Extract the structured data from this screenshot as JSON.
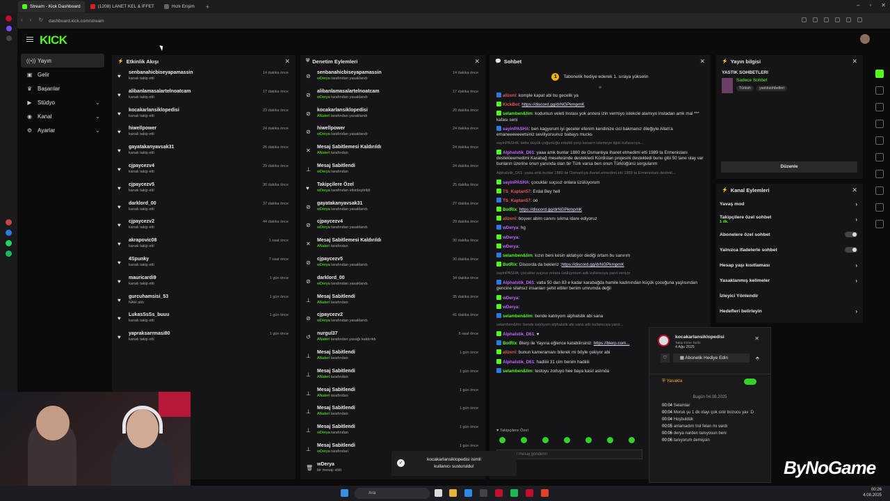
{
  "browser": {
    "tabs": [
      {
        "label": "Stream - Kick Dashboard",
        "active": true
      },
      {
        "label": "(1208) LANET KEL & İFFET",
        "active": false
      },
      {
        "label": "Hızlı Erişim",
        "active": false
      }
    ],
    "url": "dashboard.kick.com/stream"
  },
  "brand": {
    "logo": "KICK",
    "accent": "#53fc18"
  },
  "sidenav": {
    "items": [
      {
        "label": "Yayın",
        "icon": "broadcast-icon",
        "active": true,
        "chevron": false
      },
      {
        "label": "Gelir",
        "icon": "wallet-icon",
        "active": false,
        "chevron": false
      },
      {
        "label": "Başarılar",
        "icon": "trophy-icon",
        "active": false,
        "chevron": false
      },
      {
        "label": "Stüdyo",
        "icon": "video-icon",
        "active": false,
        "chevron": true
      },
      {
        "label": "Kanal",
        "icon": "channel-icon",
        "active": false,
        "chevron": true
      },
      {
        "label": "Ayarlar",
        "icon": "gear-icon",
        "active": false,
        "chevron": true
      }
    ]
  },
  "activity": {
    "title": "Etkinlik Akışı",
    "rows": [
      {
        "name": "senbanahicbiseyapamassin",
        "sub": "kanalı takip etti",
        "time": "14 dakika önce"
      },
      {
        "name": "alibanlamasalartelnoatcam",
        "sub": "kanalı takip etti",
        "time": "17 dakika önce"
      },
      {
        "name": "kocakarlansiklopedisi",
        "sub": "kanalı takip etti",
        "time": "23 dakika önce"
      },
      {
        "name": "hiwellpower",
        "sub": "kanalı takip etti",
        "time": "24 dakika önce"
      },
      {
        "name": "gayatakanyavsak31",
        "sub": "kanalı takip etti",
        "time": "26 dakika önce"
      },
      {
        "name": "cjpaycezv4",
        "sub": "kanalı takip etti",
        "time": "29 dakika önce"
      },
      {
        "name": "cjpaycezv5",
        "sub": "kanalı takip etti",
        "time": "30 dakika önce"
      },
      {
        "name": "darklord_00",
        "sub": "kanalı takip etti",
        "time": "37 dakika önce"
      },
      {
        "name": "cjpaycezv2",
        "sub": "kanalı takip etti",
        "time": "44 dakika önce"
      },
      {
        "name": "akrapovic08",
        "sub": "kanalı takip etti",
        "time": "1 saat önce"
      },
      {
        "name": "4Spunky",
        "sub": "kanalı takip etti",
        "time": "7 saat önce"
      },
      {
        "name": "mauricardi9",
        "sub": "kanalı takip etti",
        "time": "1 gün önce"
      },
      {
        "name": "gurcuhamsisi_53",
        "sub": "NAH aldı",
        "time": "1 gün önce"
      },
      {
        "name": "LukasSsSs_buuu",
        "sub": "kanalı takip etti",
        "time": "1 gün önce"
      },
      {
        "name": "yapraksarrmasi80",
        "sub": "kanalı takip etti",
        "time": "1 gün önce"
      }
    ]
  },
  "moderation": {
    "title": "Denetim Eylemleri",
    "rows": [
      {
        "icon": "ban-icon",
        "name": "senbanahicbiseyapamassin",
        "by": "wDerya",
        "sub": " tarafından yasaklandı",
        "time": "14 dakika önce"
      },
      {
        "icon": "ban-icon",
        "name": "alibanlamasalartelnoatcam",
        "by": "wDerya",
        "sub": " tarafından yasaklandı",
        "time": "17 dakika önce"
      },
      {
        "icon": "ban-icon",
        "name": "kocakarlansiklopedisi",
        "by": "ANaterl",
        "sub": " tarafından yasaklandı",
        "time": "20 dakika önce"
      },
      {
        "icon": "ban-icon",
        "name": "hiwellpower",
        "by": "wDerya",
        "sub": " tarafından yasaklandı",
        "time": "24 dakika önce"
      },
      {
        "icon": "unpin-icon",
        "name": "Mesaj Sabitlemesi Kaldırıldı",
        "by": "ANaterl",
        "sub": " tarafından",
        "time": "24 dakika önce"
      },
      {
        "icon": "pin-icon",
        "name": "Mesaj Sabitlendi",
        "by": "wDerya",
        "sub": " tarafından",
        "time": "24 dakika önce"
      },
      {
        "icon": "heart-icon",
        "name": "Takipçilere Özel",
        "by": "wDerya",
        "sub": " tarafından etkinleştirildi",
        "time": "25 dakika önce"
      },
      {
        "icon": "ban-icon",
        "name": "gayatakanyavsak31",
        "by": "wDerya",
        "sub": " tarafından yasaklandı",
        "time": "27 dakika önce"
      },
      {
        "icon": "ban-icon",
        "name": "cjpaycezv4",
        "by": "wDerya",
        "sub": " tarafından yasaklandı",
        "time": "29 dakika önce"
      },
      {
        "icon": "unpin-icon",
        "name": "Mesaj Sabitlemesi Kaldırıldı",
        "by": "ANaterl",
        "sub": " tarafından",
        "time": "30 dakika önce"
      },
      {
        "icon": "ban-icon",
        "name": "cjpaycezv5",
        "by": "wDerya",
        "sub": " tarafından yasaklandı",
        "time": "30 dakika önce"
      },
      {
        "icon": "ban-icon",
        "name": "darklord_00",
        "by": "wDerya",
        "sub": " tarafından yasaklandı",
        "time": "34 dakika önce"
      },
      {
        "icon": "pin-icon",
        "name": "Mesaj Sabitlendi",
        "by": "ANaterl",
        "sub": " tarafından",
        "time": "35 dakika önce"
      },
      {
        "icon": "ban-icon",
        "name": "cjpaycezv2",
        "by": "wDerya",
        "sub": " tarafından yasaklandı",
        "time": "41 dakika önce"
      },
      {
        "icon": "undo-icon",
        "name": "nurgul37",
        "by": "ANaterl",
        "sub": " tarafından yasağı kaldırıldı",
        "time": "5 saat önce"
      },
      {
        "icon": "pin-icon",
        "name": "Mesaj Sabitlendi",
        "by": "ANaterl",
        "sub": " tarafından",
        "time": "1 gün önce"
      },
      {
        "icon": "pin-icon",
        "name": "Mesaj Sabitlendi",
        "by": "ANaterl",
        "sub": " tarafından",
        "time": "1 gün önce"
      },
      {
        "icon": "pin-icon",
        "name": "Mesaj Sabitlendi",
        "by": "ANaterl",
        "sub": " tarafından",
        "time": "1 gün önce"
      },
      {
        "icon": "pin-icon",
        "name": "Mesaj Sabitlendi",
        "by": "ANaterl",
        "sub": " tarafından",
        "time": "1 gün önce"
      },
      {
        "icon": "pin-icon",
        "name": "Mesaj Sabitlendi",
        "by": "wDerya",
        "sub": " tarafından",
        "time": "1 gün önce"
      },
      {
        "icon": "pin-icon",
        "name": "Mesaj Sabitlendi",
        "by": "wDerya",
        "sub": " tarafından",
        "time": "1 gün önce"
      },
      {
        "icon": "trash-icon",
        "name": "wDerya",
        "by": "",
        "sub": "bir mesajı sildi",
        "time": ""
      }
    ]
  },
  "chat": {
    "title": "Sohbet",
    "pinned": "Tabonelik hediye ederek 1. sıraya yükselin",
    "input_placeholder": "Bir mesaj gönderin",
    "followers_only": "Takipçilere Özel",
    "messages": [
      {
        "user": "alizeni",
        "color": "#e05757",
        "text": ": komple kapat abi bu gecelik ya",
        "link": ""
      },
      {
        "user": "KickBot",
        "color": "#e05757",
        "text": ": ",
        "link": "https://discord.gg/drNGPkmpmK"
      },
      {
        "user": "selamben&lim",
        "color": "#53fc18",
        "text": ": kodumun veleti lnstası yok annesi izin vermiyo istekcle atamıyo lnstadan amk mal *** kafası seni",
        "link": ""
      },
      {
        "user": "sayinPASHA",
        "color": "#c266ff",
        "text": ": ben kagyorum iyi geceler efenim kendinize cici bakmanız dileğiyle Allah'a emaneeeeeeetsiniz seviliyorsunuz babays mucks",
        "link": ""
      },
      {
        "user": "",
        "color": "#777",
        "text": "sayinPASHA: bebe büyük çoğunluğu erkekti çerçi kenarın izlemeye ilgisi kullanıcıya...",
        "link": "",
        "sys": true
      },
      {
        "user": "Alphalstik_D61",
        "color": "#c266ff",
        "text": ": yaaa amk bunlar 1880 de Osmanlıya ihanet etmedimi etti 1989 ta Ermenistanı destekleemedimi Karabağ meselesinde destekledi Kürdistan projesini destekledi bunu gibi 50 tane olay var bunların üzerine onun yanında olan bir Türk varsa ben onun Türklüğünü sorgularım",
        "link": ""
      },
      {
        "user": "",
        "color": "#777",
        "text": "Alphalstik_D61: yaaa amk bunlar 1880 de Osmanlıya ihanet etmedimi etti 1989 ta Ermenistanı destekl...",
        "link": "",
        "sys": true
      },
      {
        "user": "sayinPASHA",
        "color": "#c266ff",
        "text": ": çocuklar suçsuz onlara üzülüyorum",
        "link": ""
      },
      {
        "user": "TS_Kaptan57",
        "color": "#e05757",
        "text": ": Erdal Bey hell",
        "link": ""
      },
      {
        "user": "TS_Kaptan57",
        "color": "#e05757",
        "text": ": oo",
        "link": ""
      },
      {
        "user": "BotRix",
        "color": "#53fc18",
        "text": ": ",
        "link": "https://discord.gg/drNGPkmpmK"
      },
      {
        "user": "alizeni",
        "color": "#e05757",
        "text": ": boşver abim canını sıkma idare ediyoruz",
        "link": ""
      },
      {
        "user": "wDerya",
        "color": "#c266ff",
        "text": ": hg",
        "link": ""
      },
      {
        "user": "wDerya",
        "color": "#c266ff",
        "text": ": ",
        "link": ""
      },
      {
        "user": "wDerya",
        "color": "#c266ff",
        "text": ": ",
        "link": ""
      },
      {
        "user": "selamben&lim",
        "color": "#53fc18",
        "text": ": kızın beni kesin aldatıyor dediği ortam bu sanırım",
        "link": ""
      },
      {
        "user": "BotRix",
        "color": "#53fc18",
        "text": ": Discorda da bekleriz :",
        "link": "https://discord.gg/drNGPkmpmK"
      },
      {
        "user": "",
        "color": "#777",
        "text": "sayinPASHA: çocuklar suçsuz onlara üzülüyorum adlı kullanıcıya yanıt veriyor",
        "link": "",
        "sys": true
      },
      {
        "user": "Alphalstik_D61",
        "color": "#c266ff",
        "text": ": vatla 50 dan 83 e kadar karabağda hamile kadınından küçük çocuğuna yaşlısından gencine silahsız insanları şehit ettiler benim umrumda değil",
        "link": ""
      },
      {
        "user": "wDerya",
        "color": "#c266ff",
        "text": ": ",
        "link": ""
      },
      {
        "user": "wDerya",
        "color": "#c266ff",
        "text": ": ",
        "link": ""
      },
      {
        "user": "selamben&lim",
        "color": "#53fc18",
        "text": ": bende katılıyom alphalstik abi sana",
        "link": ""
      },
      {
        "user": "",
        "color": "#777",
        "text": "selamben&lim: bende katılıyom alphalstik abi sana adlı kullanıcıya yanıt...",
        "link": "",
        "sys": true
      },
      {
        "user": "Alphalstik_D61",
        "color": "#c266ff",
        "text": ": ♥",
        "link": ""
      },
      {
        "user": "BotRix",
        "color": "#53fc18",
        "text": ": Blerp ile Yayına eğlence katabilirsiniz: ",
        "link": "https://blerp.com..."
      },
      {
        "user": "alizeni",
        "color": "#e05757",
        "text": ": bunun kameramanı bilerek mi böyle çekiyor abi",
        "link": ""
      },
      {
        "user": "Alphalstik_D61",
        "color": "#c266ff",
        "text": ": hadiiiii 31 cim benim hadiiiii",
        "link": ""
      },
      {
        "user": "selamben&lim",
        "color": "#53fc18",
        "text": ": testoyu zorluyo hee baya kasıl aslında",
        "link": ""
      }
    ]
  },
  "stream_info": {
    "title": "Yayın bilgisi",
    "stream_title": "YASTIK SOHBETLERI",
    "category": "Sadece Sohbet",
    "tags": [
      "Türkish",
      "yastıksohbetleri"
    ],
    "edit_label": "Düzenle"
  },
  "channel_actions": {
    "title": "Kanal Eylemleri",
    "items": [
      {
        "label": "Yavaş mod",
        "sub": "",
        "control": "chevron"
      },
      {
        "label": "Takipçilere özel sohbet",
        "sub": "1 dk.",
        "control": "chevron"
      },
      {
        "label": "Abonelere özel sohbet",
        "sub": "",
        "control": "toggle"
      },
      {
        "label": "Yalnızca ifadelerle sohbet",
        "sub": "",
        "control": "toggle"
      },
      {
        "label": "Hesap yaşı kısıtlaması",
        "sub": "",
        "control": "chevron"
      },
      {
        "label": "Yasaklanmış kelimeler",
        "sub": "",
        "control": "chevron"
      },
      {
        "label": "İzleyici Yönlendir",
        "sub": "",
        "control": "none"
      },
      {
        "label": "Hedefleri belirleyin",
        "sub": "",
        "control": "chevron"
      }
    ]
  },
  "user_popup": {
    "username": "kocakarlansiklopedisi",
    "follow_label": "Takip Etme Tarihi",
    "follow_date": "4 Ağu 2025",
    "gift_label": "Abonelik Hediye Edin",
    "ban_label": "Yasakla",
    "date_header": "Bugün 04.08.2025",
    "log": [
      {
        "time": "00:04",
        "text": "Selamlar"
      },
      {
        "time": "00:04",
        "text": "Moruk şu 1 dk olayı çok sinir bozucu yav :D"
      },
      {
        "time": "00:04",
        "text": "Hoşbuldük"
      },
      {
        "time": "00:05",
        "text": "anlamadım trol felan mı vardı"
      },
      {
        "time": "00:06",
        "text": "derya narden tanıyosun beni"
      },
      {
        "time": "00:06",
        "text": "tanıyorum demişsin"
      }
    ]
  },
  "toast": {
    "text": "kocakarlansiklopedisi isimli kullanıcı susturuldu!"
  },
  "taskbar": {
    "search": "Ara",
    "time": "00:26",
    "date": "4.08.2025"
  },
  "watermark": "ByNoGame"
}
